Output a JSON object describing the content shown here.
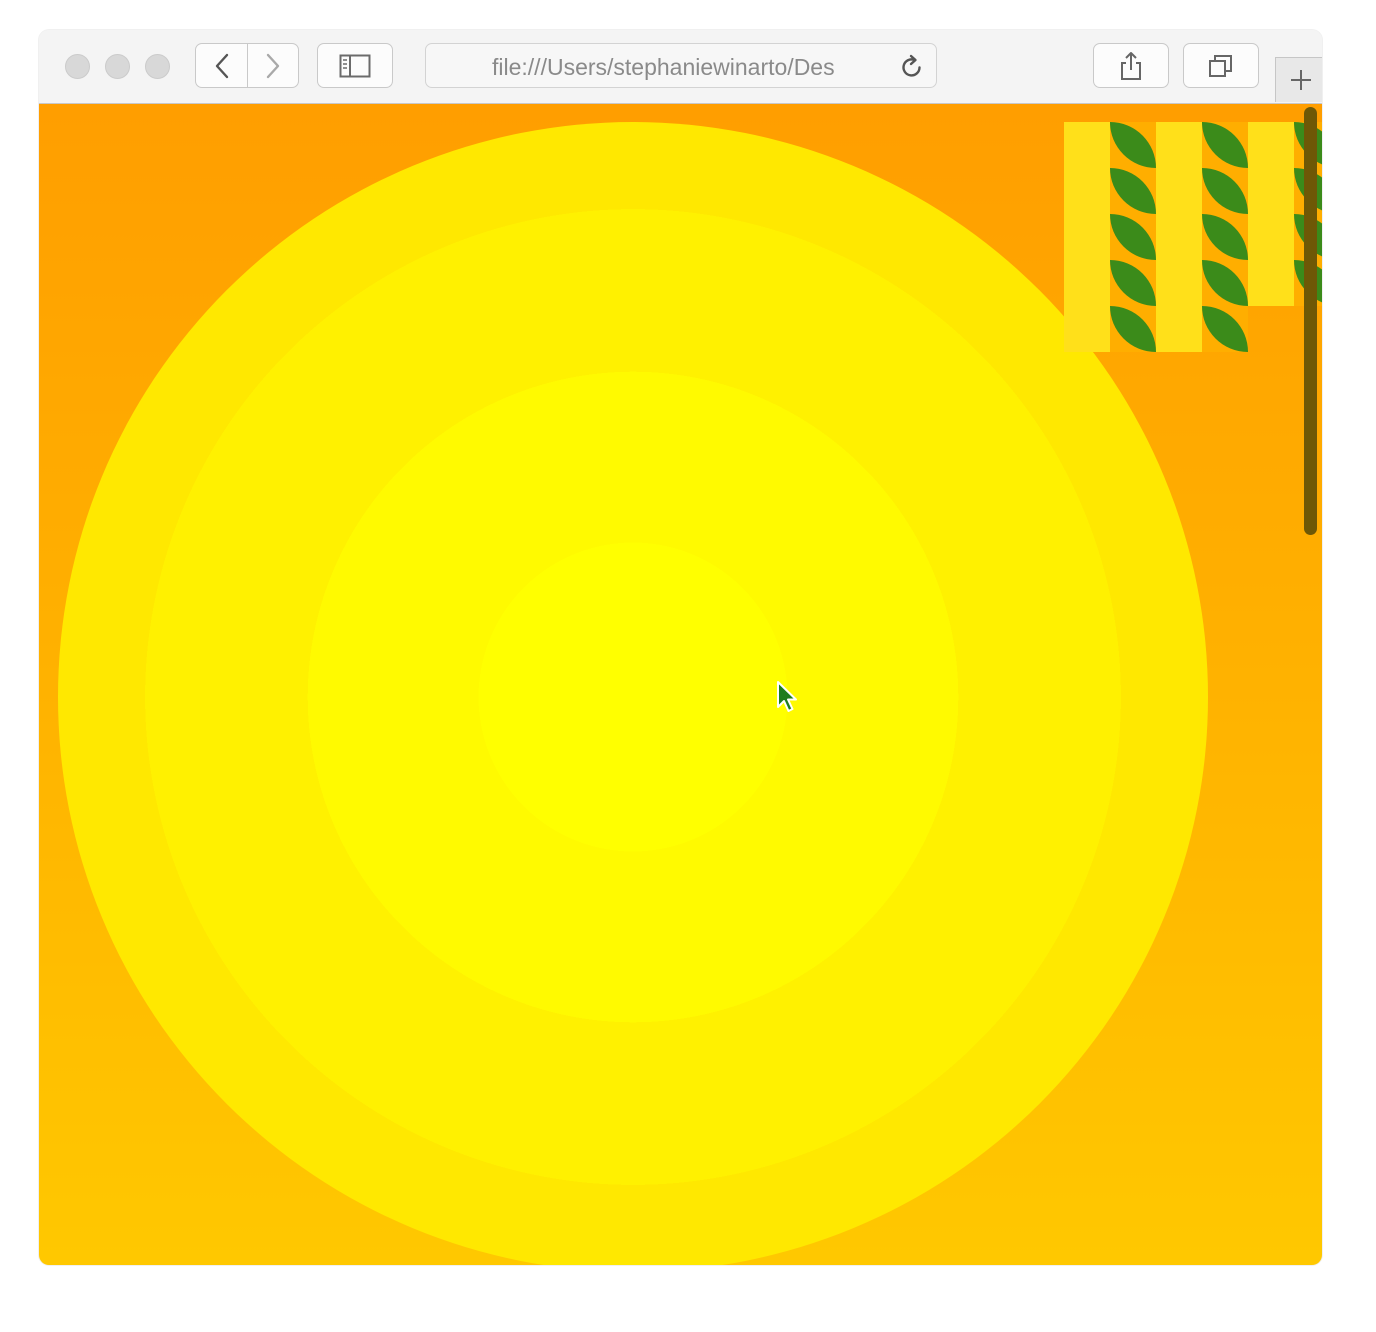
{
  "browser": {
    "address_bar": {
      "url": "file:///Users/stephaniewinarto/Des"
    },
    "icons": {
      "back": "chevron-left-icon",
      "forward": "chevron-right-icon",
      "sidebar": "sidebar-icon",
      "reload": "reload-icon",
      "share": "share-icon",
      "tabs": "tabs-overview-icon",
      "new_tab": "plus-icon"
    }
  },
  "page": {
    "background_colors": [
      "#ff9e00",
      "#ffc800"
    ],
    "sun_colors": [
      "#ffff00",
      "#fffa00",
      "#fff100",
      "#ffe800",
      "#ffdd00"
    ],
    "pattern_colors": {
      "stripe": "#ffe01a",
      "leaf": "#3b8b1a"
    },
    "scrollbar_color": "#6e5806"
  }
}
